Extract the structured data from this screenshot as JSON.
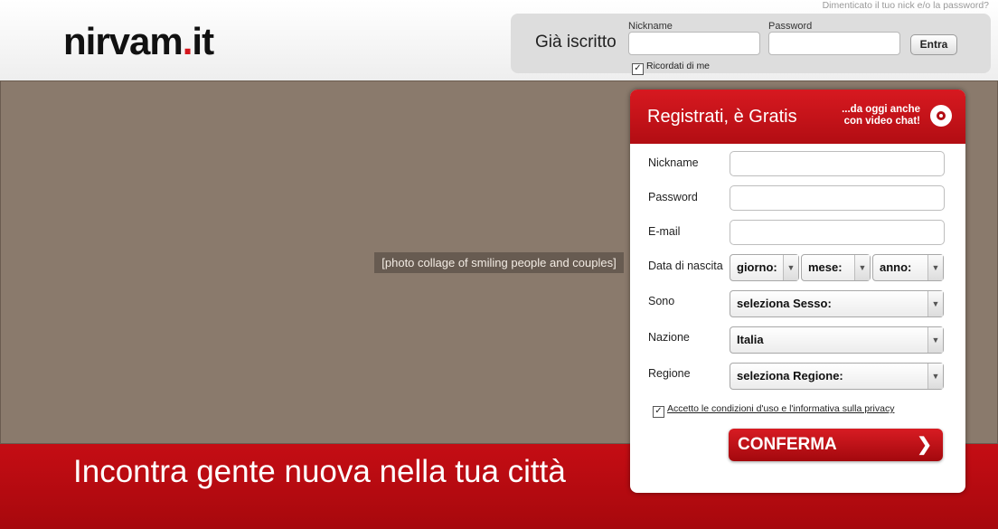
{
  "header": {
    "logo_main": "nirvam",
    "logo_dot": ".",
    "logo_tld": "it",
    "forgot_link": "Dimenticato il tuo nick e/o la password?"
  },
  "login": {
    "title": "Già iscritto",
    "nickname_label": "Nickname",
    "password_label": "Password",
    "submit_label": "Entra",
    "remember_label": "Ricordati di me",
    "remember_checked": true
  },
  "collage": {
    "label": "[photo collage of smiling people and couples]"
  },
  "banner": {
    "tagline": "Incontra gente nuova nella tua città"
  },
  "register": {
    "title": "Registrati, è Gratis",
    "subtitle_line1": "...da oggi anche",
    "subtitle_line2": "con video chat!",
    "camera_icon": "webcam-icon",
    "nickname_label": "Nickname",
    "password_label": "Password",
    "email_label": "E-mail",
    "birth_label": "Data di nascita",
    "day_select": "giorno:",
    "month_select": "mese:",
    "year_select": "anno:",
    "gender_label": "Sono",
    "gender_select": "seleziona Sesso:",
    "country_label": "Nazione",
    "country_select": "Italia",
    "region_label": "Regione",
    "region_select": "seleziona Regione:",
    "privacy_label": "Accetto le condizioni d'uso e l'informativa sulla privacy",
    "privacy_checked": true,
    "confirm_label": "CONFERMA",
    "confirm_icon": "chevron-right-icon"
  },
  "colors": {
    "brand_red": "#c50d14",
    "heart_red": "#d4161d"
  }
}
